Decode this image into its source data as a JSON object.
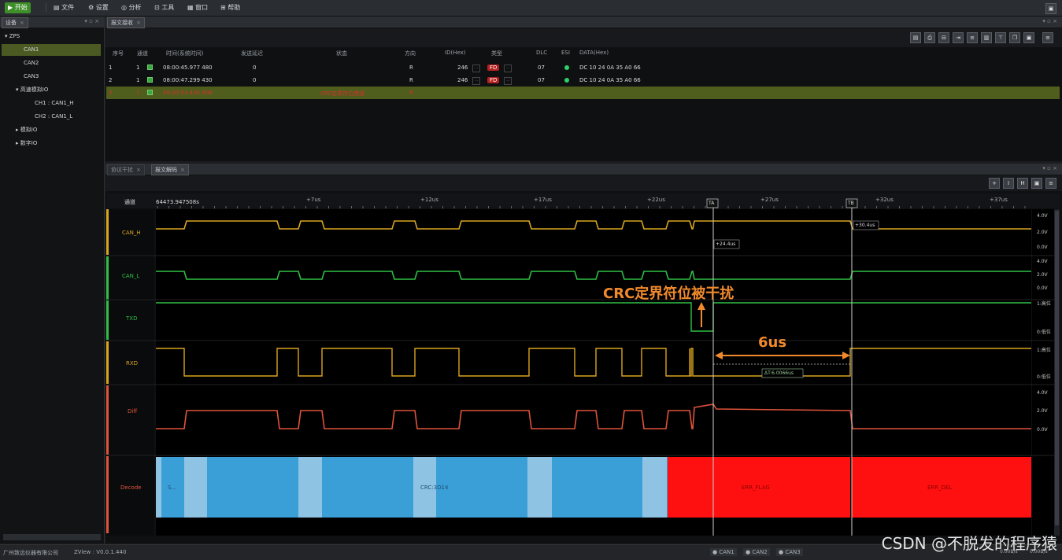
{
  "toolbar": {
    "start": "开始",
    "file": "文件",
    "settings": "设置",
    "analysis": "分析",
    "tools": "工具",
    "window": "窗口",
    "help": "帮助"
  },
  "left_panel": {
    "title": "设备",
    "tree": [
      "ZPS",
      "CAN1",
      "CAN2",
      "CAN3",
      "高速模拟IO",
      "CH1 : CAN1_H",
      "CH2 : CAN1_L",
      "模拟IO",
      "数字IO"
    ]
  },
  "msg_panel": {
    "tab": "报文接收",
    "columns": [
      "序号",
      "通道",
      "时间(系统时间)",
      "发送延迟",
      "状态",
      "方向",
      "ID(Hex)",
      "类型",
      "DLC",
      "ESI",
      "DATA(Hex)"
    ],
    "rows": [
      {
        "seq": "1",
        "ch": "1",
        "time": "08:00:45.977 480",
        "delay": "0",
        "status": "",
        "dir": "R",
        "id": "246",
        "type": "FD",
        "dlc": "07",
        "data": "DC 10 24 0A 35 A0 66"
      },
      {
        "seq": "2",
        "ch": "1",
        "time": "08:00:47.299 430",
        "delay": "0",
        "status": "",
        "dir": "R",
        "id": "246",
        "type": "FD",
        "dlc": "07",
        "data": "DC 10 24 0A 35 A0 66"
      },
      {
        "seq": "3",
        "ch": "1",
        "time": "08:00:53.436 908",
        "delay": "",
        "status": "CRC定界符位错误",
        "dir": "R",
        "id": "",
        "type": "",
        "dlc": "",
        "data": ""
      }
    ]
  },
  "wave_panel": {
    "tab_inactive": "协议干扰",
    "tab_active": "报文解码",
    "channel_header": "通道",
    "start_time": "64473.947508s",
    "time_ticks": [
      "+7us",
      "+12us",
      "+17us",
      "+22us",
      "+27us",
      "+32us",
      "+37us"
    ],
    "cursor_a": "TA",
    "cursor_b": "TB",
    "cursor_a_delta": "+24.4us",
    "cursor_b_delta": "+30.4us",
    "delta_label": "ΔT:6.0066us",
    "channels": [
      "CAN_H",
      "CAN_L",
      "TXD",
      "RXD",
      "Diff",
      "Decode"
    ],
    "volt_ticks_h": [
      "4.0V",
      "2.0V",
      "0.0V"
    ],
    "volt_ticks_l": [
      "4.0V",
      "2.0V",
      "0.0V"
    ],
    "digital_hi": "1:高位",
    "digital_lo": "0:低位",
    "diff_ticks": [
      "4.0V",
      "2.0V",
      "0.0V"
    ],
    "decode_segments": [
      {
        "label": "S...",
        "color": "#3a9fd6"
      },
      {
        "label": "CRC:3D14",
        "color": "#3a9fd6"
      },
      {
        "label": "ERR_FLAG",
        "color": "#ff1010"
      },
      {
        "label": "ERR_DEL",
        "color": "#ff1010"
      }
    ],
    "annotation": "CRC定界符位被干扰",
    "annotation_6us": "6us"
  },
  "status_bar": {
    "company": "广州致远仪器有限公司",
    "version": "ZView : V0.0.1.440",
    "can1": "CAN1",
    "can2": "CAN2",
    "can3": "CAN3",
    "rate1": "0.00B/s",
    "rate2": "0.00B/s"
  },
  "watermark": "CSDN @不脱发的程序猿",
  "colors": {
    "can_h": "#d9a520",
    "can_l": "#2fbf45",
    "txd": "#2fbf45",
    "rxd": "#d9a520",
    "diff": "#e0543a",
    "decode_blue": "#3a9fd6",
    "decode_light": "#8fc3e3",
    "decode_red": "#ff1010",
    "annotation": "#f08a2c"
  }
}
